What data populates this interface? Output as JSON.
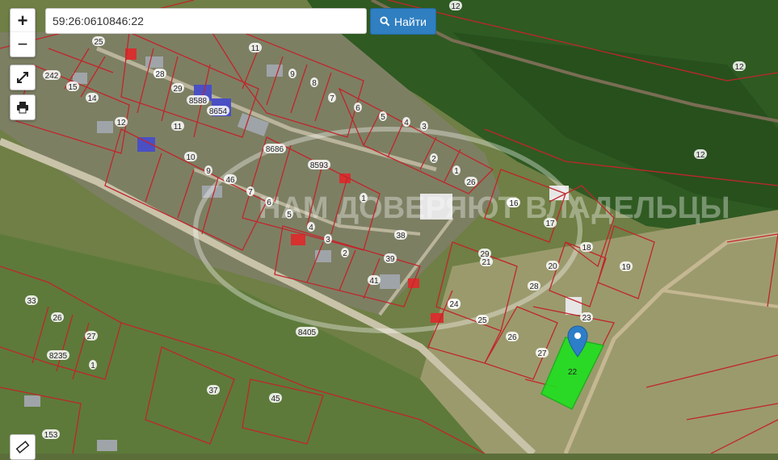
{
  "search": {
    "value": "59:26:0610846:22",
    "button_label": "Найти"
  },
  "controls": {
    "zoom_in": "+",
    "zoom_out": "−"
  },
  "selected_parcel_label": "22",
  "watermark": "НАМ ДОВЕРЯЮТ ВЛАДЕЛЬЦЫ",
  "parcel_labels": [
    "12",
    "12",
    "12",
    "25",
    "11",
    "9",
    "8",
    "7",
    "6",
    "5",
    "4",
    "3",
    "2",
    "1",
    "26",
    "24",
    "16",
    "15",
    "14",
    "12",
    "11",
    "10",
    "9",
    "8",
    "28",
    "29",
    "8588",
    "8654",
    "8686",
    "8593",
    "46",
    "7",
    "6",
    "5",
    "4",
    "3",
    "2",
    "1",
    "16",
    "17",
    "18",
    "19",
    "20",
    "21",
    "29",
    "28",
    "38",
    "39",
    "41",
    "24",
    "25",
    "26",
    "27",
    "23",
    "8405",
    "33",
    "26",
    "27",
    "8235",
    "1",
    "37",
    "45",
    "153",
    "242"
  ],
  "colors": {
    "parcel_border": "#c0262b",
    "selected_fill": "#1ee01e",
    "marker": "#2c7ec8",
    "button": "#2f7fc1"
  }
}
